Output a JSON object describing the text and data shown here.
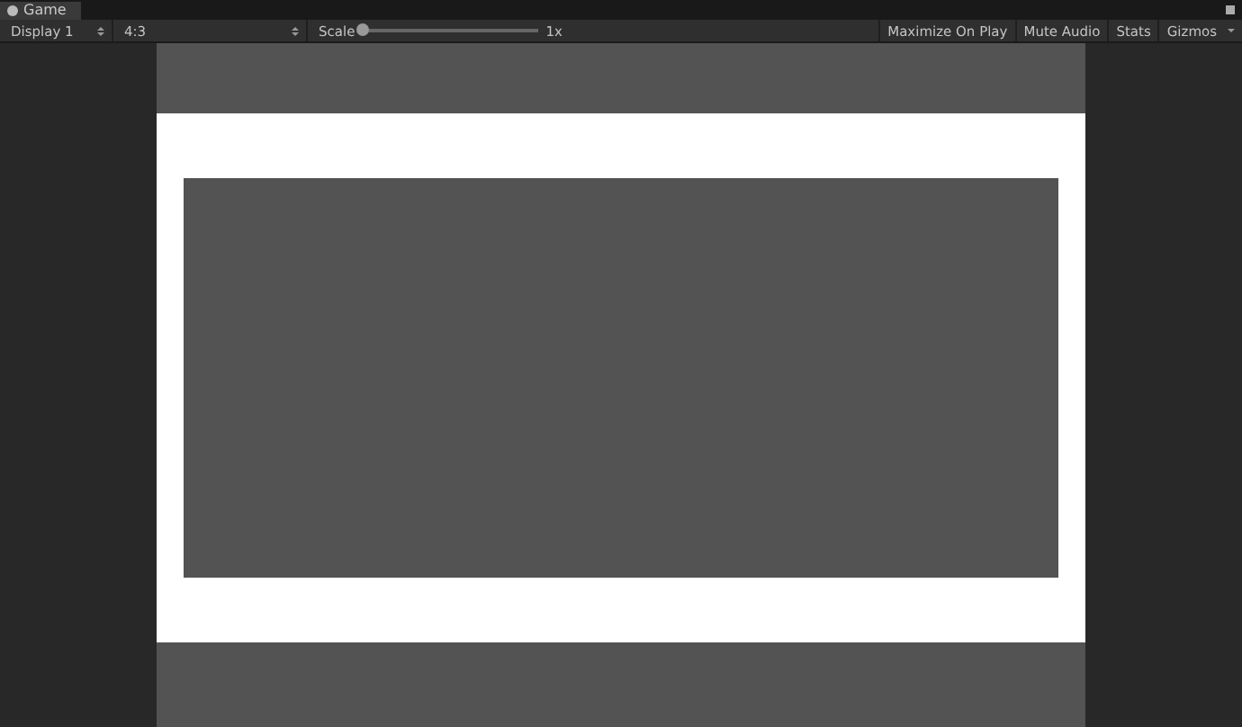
{
  "tab": {
    "title": "Game"
  },
  "toolbar": {
    "display": "Display 1",
    "aspect": "4:3",
    "scale_label": "Scale",
    "scale": {
      "level": 0,
      "reading": "1x"
    },
    "toggles": [
      {
        "label": "Maximize On Play",
        "on": false
      },
      {
        "label": "Mute Audio",
        "on": false
      },
      {
        "label": "Stats",
        "on": false
      }
    ],
    "gizmos": "Gizmos"
  }
}
